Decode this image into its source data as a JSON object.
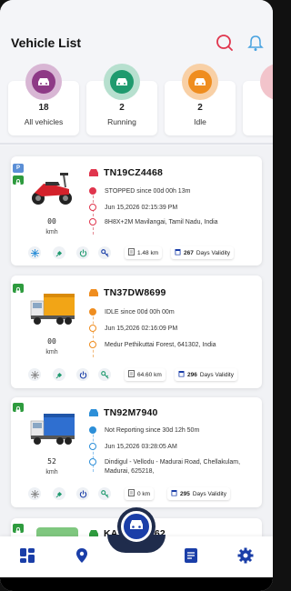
{
  "header": {
    "title": "Vehicle List",
    "icons": [
      "search-icon",
      "notification-bell-icon"
    ]
  },
  "stats": [
    {
      "count": "18",
      "label": "All vehicles",
      "color": "#8e3a86",
      "ring": "#d8b6d4"
    },
    {
      "count": "2",
      "label": "Running",
      "color": "#1f9a6e",
      "ring": "#b7e0cf"
    },
    {
      "count": "2",
      "label": "Idle",
      "color": "#ef8d1f",
      "ring": "#f8d0a6"
    }
  ],
  "vehicles": [
    {
      "plate": "TN19CZ4468",
      "status_color": "#e0354d",
      "status": "STOPPED since  00d 00h 13m",
      "datetime": "Jun 15,2026 02:15:39 PM",
      "address": "8H8X+2M Mavilangai, Tamil Nadu, India",
      "speed": "00",
      "speed_unit": "kmh",
      "distance": "1.48 km",
      "validity_days": "267",
      "validity_label": "Days Validity",
      "p_badge": "P"
    },
    {
      "plate": "TN37DW8699",
      "status_color": "#ef8d1f",
      "status": "IDLE since  00d 00h 00m",
      "datetime": "Jun 15,2026 02:16:09 PM",
      "address": "Medur Pethikuttai Forest, 641302, India",
      "speed": "00",
      "speed_unit": "kmh",
      "distance": "64.60 km",
      "validity_days": "296",
      "validity_label": "Days Validity"
    },
    {
      "plate": "TN92M7940",
      "status_color": "#2d8fd8",
      "status": "Not Reporting since  30d 12h 50m",
      "datetime": "Jun 15,2026 03:28:05 AM",
      "address": "Dindigul - Vellodu - Madurai Road, Chellakulam, Madurai, 625218,",
      "speed": "52",
      "speed_unit": "kmh",
      "distance": "0 km",
      "validity_days": "295",
      "validity_label": "Days Validity"
    },
    {
      "plate": "KA51AG1062",
      "status_color": "#2e9b3e"
    }
  ],
  "bottom_nav": [
    "dashboard-icon",
    "location-icon",
    "vehicle-icon",
    "report-icon",
    "settings-icon"
  ],
  "colors": {
    "accent": "#1a3ea8",
    "lock": "#2e9b3e"
  }
}
